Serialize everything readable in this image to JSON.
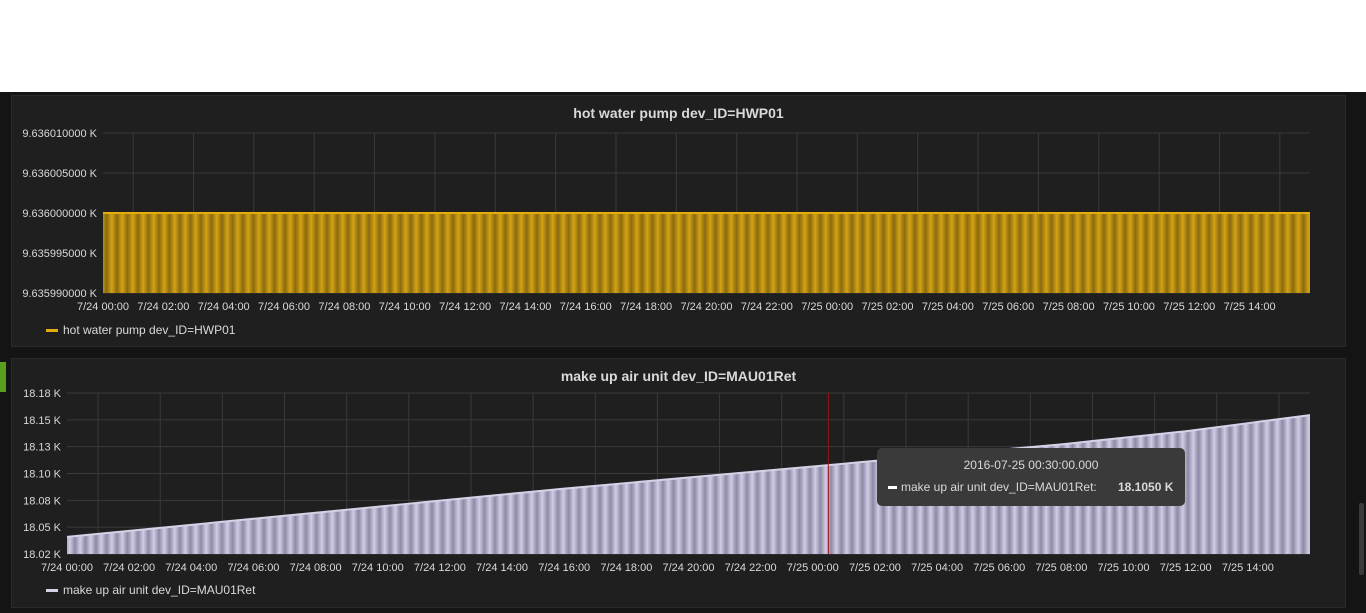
{
  "colors": {
    "background": "#141414",
    "panel": "#1f1f20",
    "grid": "#3a3a3a",
    "text": "#d8d9da",
    "series1": "#e5ac0e",
    "series2": "#d5d2e8",
    "crosshair": "#a01010"
  },
  "chart_data": [
    {
      "type": "area",
      "title": "hot water pump dev_ID=HWP01",
      "xlabel": "",
      "ylabel": "",
      "x_ticks": [
        "7/24 00:00",
        "7/24 02:00",
        "7/24 04:00",
        "7/24 06:00",
        "7/24 08:00",
        "7/24 10:00",
        "7/24 12:00",
        "7/24 14:00",
        "7/24 16:00",
        "7/24 18:00",
        "7/24 20:00",
        "7/24 22:00",
        "7/25 00:00",
        "7/25 02:00",
        "7/25 04:00",
        "7/25 06:00",
        "7/25 08:00",
        "7/25 10:00",
        "7/25 12:00",
        "7/25 14:00"
      ],
      "y_ticks": [
        "9.636010000 K",
        "9.636005000 K",
        "9.636000000 K",
        "9.635995000 K",
        "9.635990000 K"
      ],
      "ylim": [
        9.63599,
        9.63601
      ],
      "x_range_hours": [
        0,
        40
      ],
      "grid": true,
      "legend_position": "bottom-left",
      "series": [
        {
          "name": "hot water pump dev_ID=HWP01",
          "x_hours": [
            0,
            40
          ],
          "values": [
            9.636,
            9.636
          ]
        }
      ]
    },
    {
      "type": "area",
      "title": "make up air unit dev_ID=MAU01Ret",
      "xlabel": "",
      "ylabel": "",
      "x_ticks": [
        "7/24 00:00",
        "7/24 02:00",
        "7/24 04:00",
        "7/24 06:00",
        "7/24 08:00",
        "7/24 10:00",
        "7/24 12:00",
        "7/24 14:00",
        "7/24 16:00",
        "7/24 18:00",
        "7/24 20:00",
        "7/24 22:00",
        "7/25 00:00",
        "7/25 02:00",
        "7/25 04:00",
        "7/25 06:00",
        "7/25 08:00",
        "7/25 10:00",
        "7/25 12:00",
        "7/25 14:00"
      ],
      "y_ticks": [
        "18.18 K",
        "18.15 K",
        "18.13 K",
        "18.10 K",
        "18.08 K",
        "18.05 K",
        "18.02 K"
      ],
      "ylim": [
        18.02,
        18.18
      ],
      "x_range_hours": [
        0,
        40
      ],
      "grid": true,
      "legend_position": "bottom-left",
      "series": [
        {
          "name": "make up air unit dev_ID=MAU01Ret",
          "x_hours": [
            0,
            4,
            8,
            12,
            16,
            20,
            24,
            28,
            32,
            36,
            40
          ],
          "values": [
            18.037,
            18.049,
            18.061,
            18.073,
            18.085,
            18.096,
            18.107,
            18.118,
            18.129,
            18.142,
            18.158
          ]
        }
      ]
    }
  ],
  "tooltip": {
    "time": "2016-07-25 00:30:00.000",
    "series": "make up air unit dev_ID=MAU01Ret:",
    "value": "18.1050 K",
    "x_hours": 24.5
  }
}
